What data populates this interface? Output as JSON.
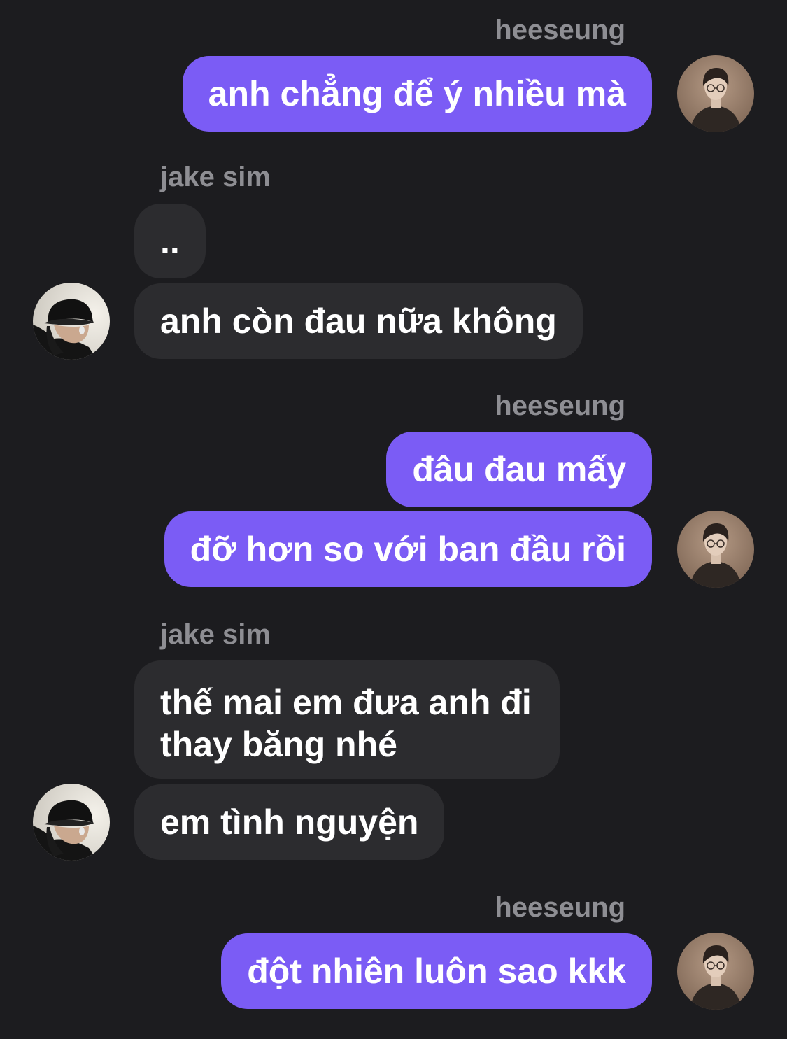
{
  "messages": [
    {
      "sender": "heeseung",
      "side": "right",
      "bubbles": [
        "anh chẳng để ý nhiều mà"
      ]
    },
    {
      "sender": "jake sim",
      "side": "left",
      "bubbles": [
        "..",
        "anh còn đau nữa không"
      ]
    },
    {
      "sender": "heeseung",
      "side": "right",
      "bubbles": [
        "đâu đau mấy",
        "đỡ hơn so với ban đầu rồi"
      ]
    },
    {
      "sender": "jake sim",
      "side": "left",
      "bubbles": [
        "thế mai em đưa anh đi thay băng nhé",
        "em tình nguyện"
      ]
    },
    {
      "sender": "heeseung",
      "side": "right",
      "bubbles": [
        "đột nhiên luôn sao kkk"
      ]
    }
  ],
  "colors": {
    "background": "#1c1c1f",
    "outgoing_bubble": "#7b5cf5",
    "incoming_bubble": "#2c2c2f",
    "sender_name": "#8e8e93",
    "text": "#ffffff"
  },
  "icons": {
    "heeseung_avatar": "heeseung-avatar-icon",
    "jake_avatar": "jake-sim-avatar-icon"
  }
}
